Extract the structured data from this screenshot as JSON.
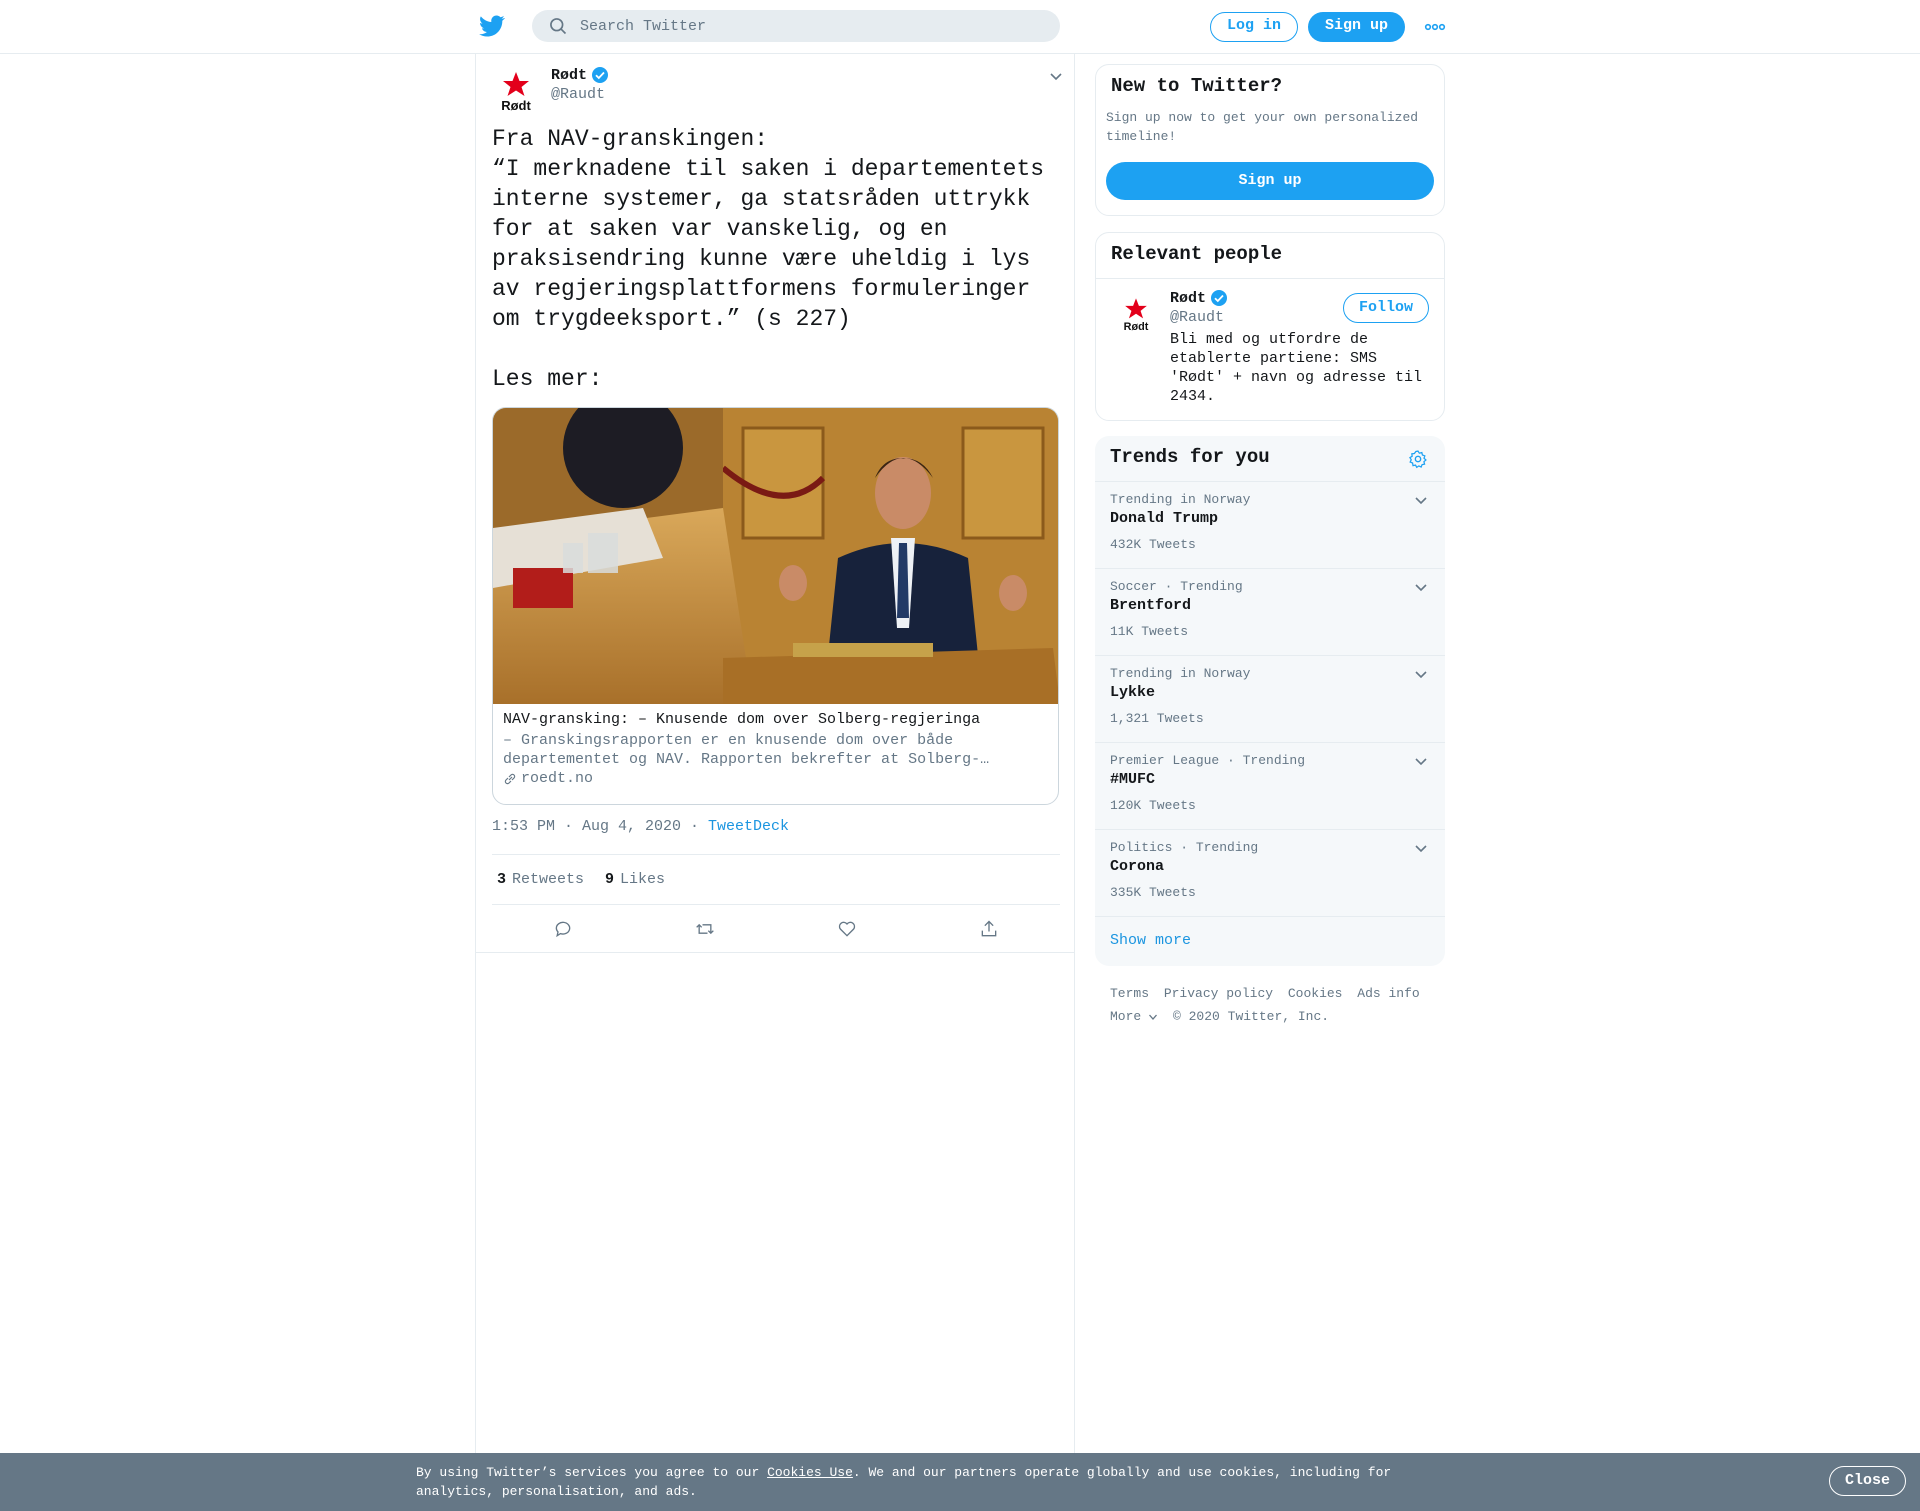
{
  "header": {
    "search_placeholder": "Search Twitter",
    "login_label": "Log in",
    "signup_label": "Sign up"
  },
  "tweet": {
    "author_name": "Rødt",
    "author_handle": "@Raudt",
    "avatar_text": "Rødt",
    "text": "Fra NAV-granskingen:\n“I merknadene til saken i departementets interne systemer, ga statsråden uttrykk for at saken var vanskelig, og en praksisendring kunne være uheldig i lys av regjeringsplattformens formuleringer om trygdeeksport.” (s 227)\n\nLes mer:",
    "card": {
      "title": "NAV-gransking: – Knusende dom over Solberg-regjeringa",
      "description": "– Granskingsrapporten er en knusende dom over både departementet og NAV. Rapporten bekrefter at Solberg-…",
      "domain": "roedt.no"
    },
    "time": "1:53 PM · Aug 4, 2020",
    "separator": " · ",
    "source": "TweetDeck",
    "retweets_count": "3",
    "retweets_label": "Retweets",
    "likes_count": "9",
    "likes_label": "Likes"
  },
  "sidebar": {
    "new_to_twitter": {
      "title": "New to Twitter?",
      "text": "Sign up now to get your own personalized timeline!",
      "button": "Sign up"
    },
    "relevant_people": {
      "title": "Relevant people",
      "name": "Rødt",
      "handle": "@Raudt",
      "follow_label": "Follow",
      "bio": "Bli med og utfordre de etablerte partiene: SMS 'Rødt' + navn og adresse til 2434."
    },
    "trends": {
      "title": "Trends for you",
      "items": [
        {
          "context": "Trending in Norway",
          "name": "Donald Trump",
          "count": "432K Tweets"
        },
        {
          "context": "Soccer · Trending",
          "name": "Brentford",
          "count": "11K Tweets"
        },
        {
          "context": "Trending in Norway",
          "name": "Lykke",
          "count": "1,321 Tweets"
        },
        {
          "context": "Premier League · Trending",
          "name": "#MUFC",
          "count": "120K Tweets"
        },
        {
          "context": "Politics · Trending",
          "name": "Corona",
          "count": "335K Tweets"
        }
      ],
      "show_more": "Show more"
    },
    "footer": {
      "terms": "Terms",
      "privacy": "Privacy policy",
      "cookies": "Cookies",
      "ads": "Ads info",
      "more": "More",
      "copyright": "© 2020 Twitter, Inc."
    }
  },
  "cookie_bar": {
    "text_before": "By using Twitter’s services you agree to our ",
    "link": "Cookies Use",
    "text_after": ". We and our partners operate globally and use cookies, including for analytics, personalisation, and ads.",
    "close_label": "Close"
  },
  "colors": {
    "brand": "#1da1f2",
    "link": "#1b95e0",
    "muted": "#657786",
    "cookie_bg": "#657786",
    "party_red": "#e3001b"
  }
}
